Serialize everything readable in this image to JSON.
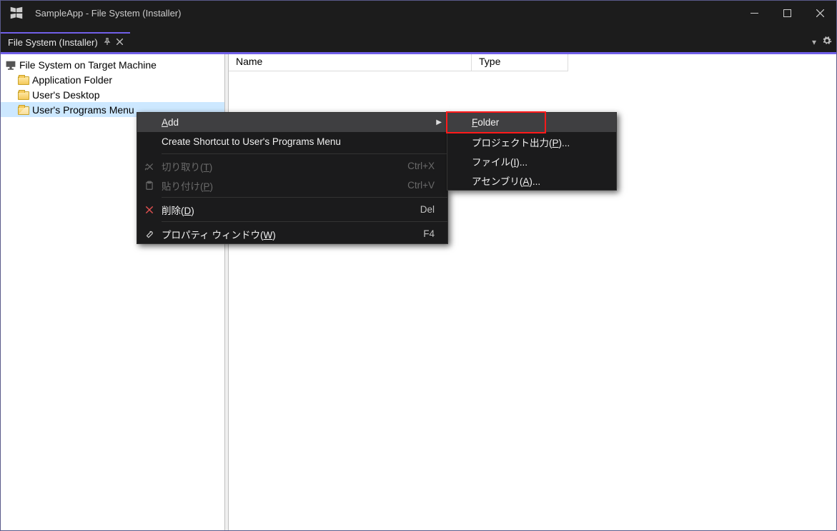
{
  "titlebar": {
    "title": "SampleApp - File System (Installer)"
  },
  "tab": {
    "label": "File System (Installer)"
  },
  "tree": {
    "root": "File System on Target Machine",
    "items": [
      {
        "label": "Application Folder"
      },
      {
        "label": "User's Desktop"
      },
      {
        "label": "User's Programs Menu"
      }
    ]
  },
  "list": {
    "col_name": "Name",
    "col_type": "Type"
  },
  "ctx_main": {
    "add": "Add",
    "shortcut": "Create Shortcut to User's Programs Menu",
    "cut": {
      "label": "切り取り(T)",
      "key": "Ctrl+X"
    },
    "paste": {
      "label": "貼り付け(P)",
      "key": "Ctrl+V"
    },
    "delete": {
      "label": "削除(D)",
      "key": "Del"
    },
    "props": {
      "label": "プロパティ ウィンドウ(W)",
      "key": "F4"
    }
  },
  "ctx_sub": {
    "folder": "Folder",
    "projout": "プロジェクト出力(P)...",
    "file": "ファイル(I)...",
    "asm": "アセンブリ(A)..."
  }
}
